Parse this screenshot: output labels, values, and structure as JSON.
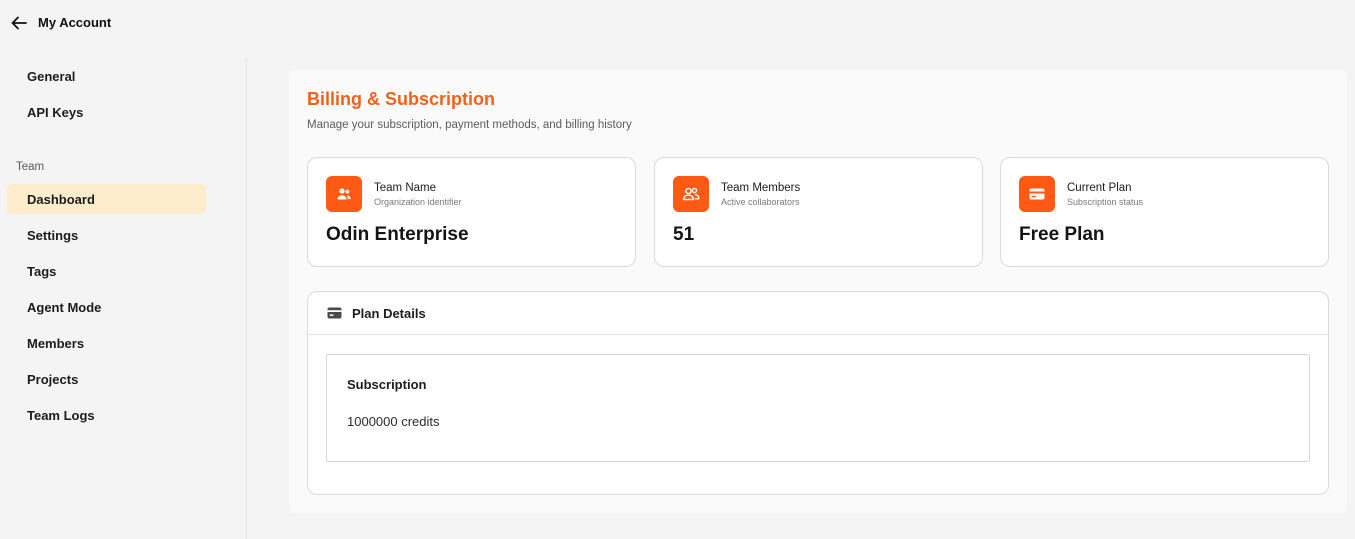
{
  "header": {
    "title": "My Account",
    "back_icon": "arrow-left-icon"
  },
  "sidebar": {
    "account_items": [
      {
        "label": "General"
      },
      {
        "label": "API Keys"
      }
    ],
    "section_label": "Team",
    "team_items": [
      {
        "label": "Dashboard",
        "active": true
      },
      {
        "label": "Settings"
      },
      {
        "label": "Tags"
      },
      {
        "label": "Agent Mode"
      },
      {
        "label": "Members"
      },
      {
        "label": "Projects"
      },
      {
        "label": "Team Logs"
      }
    ],
    "active_color": "#fdedcc"
  },
  "main": {
    "title": "Billing & Subscription",
    "subtitle": "Manage your subscription, payment methods, and billing history",
    "accent_color": "#f0611c",
    "cards": [
      {
        "label": "Team Name",
        "sublabel": "Organization identifier",
        "value": "Odin Enterprise",
        "icon": "users-icon"
      },
      {
        "label": "Team Members",
        "sublabel": "Active collaborators",
        "value": "51",
        "icon": "group-icon"
      },
      {
        "label": "Current Plan",
        "sublabel": "Subscription status",
        "value": "Free Plan",
        "icon": "credit-card-icon"
      }
    ],
    "plan_details": {
      "title": "Plan Details",
      "icon": "credit-card-icon",
      "subscription_title": "Subscription",
      "subscription_value": "1000000 credits"
    }
  }
}
